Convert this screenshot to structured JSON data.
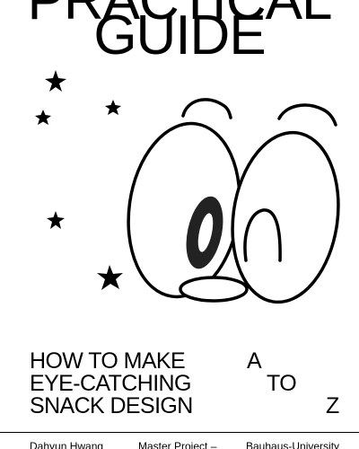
{
  "title": {
    "line1": "PRACTICAL",
    "line2": "GUIDE"
  },
  "subtitle": {
    "rows": [
      {
        "left": "HOW TO MAKE",
        "right": "A"
      },
      {
        "left": "EYE-CATCHING",
        "right": "TO"
      },
      {
        "left": "SNACK DESIGN",
        "right": "Z"
      }
    ]
  },
  "footer": {
    "author": "Dahyun Hwang",
    "project": "Master Project –",
    "university": "Bauhaus-University"
  },
  "illustration": {
    "description_icons": [
      "star-icon",
      "cartoon-eyes-face"
    ],
    "colors": {
      "ink": "#000000",
      "paper": "#ffffff"
    }
  }
}
